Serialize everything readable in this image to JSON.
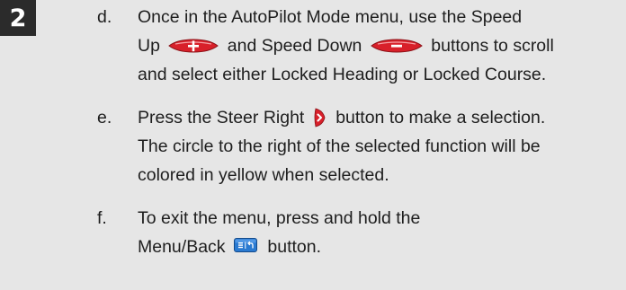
{
  "step_number": "2",
  "items": [
    {
      "letter": "d.",
      "lines": [
        [
          "Once in the AutoPilot Mode menu, use the Speed"
        ],
        [
          "Up",
          "and Speed Down",
          "buttons to scroll"
        ],
        [
          "and select either Locked Heading or Locked Course."
        ]
      ]
    },
    {
      "letter": "e.",
      "lines": [
        [
          "Press the Steer Right",
          "button to make a selection."
        ],
        [
          "The circle to the right of the selected function will be"
        ],
        [
          "colored in yellow when selected."
        ]
      ]
    },
    {
      "letter": "f.",
      "lines": [
        [
          "To exit the menu, press and hold the"
        ],
        [
          "Menu/Back",
          "button."
        ]
      ]
    }
  ],
  "icons": {
    "speed_up": "speed-up-button-icon",
    "speed_down": "speed-down-button-icon",
    "steer_right": "steer-right-button-icon",
    "menu_back": "menu-back-button-icon"
  },
  "colors": {
    "button_red": "#d8202a",
    "button_blue": "#2a7ad1",
    "badge": "#2b2b2b"
  }
}
